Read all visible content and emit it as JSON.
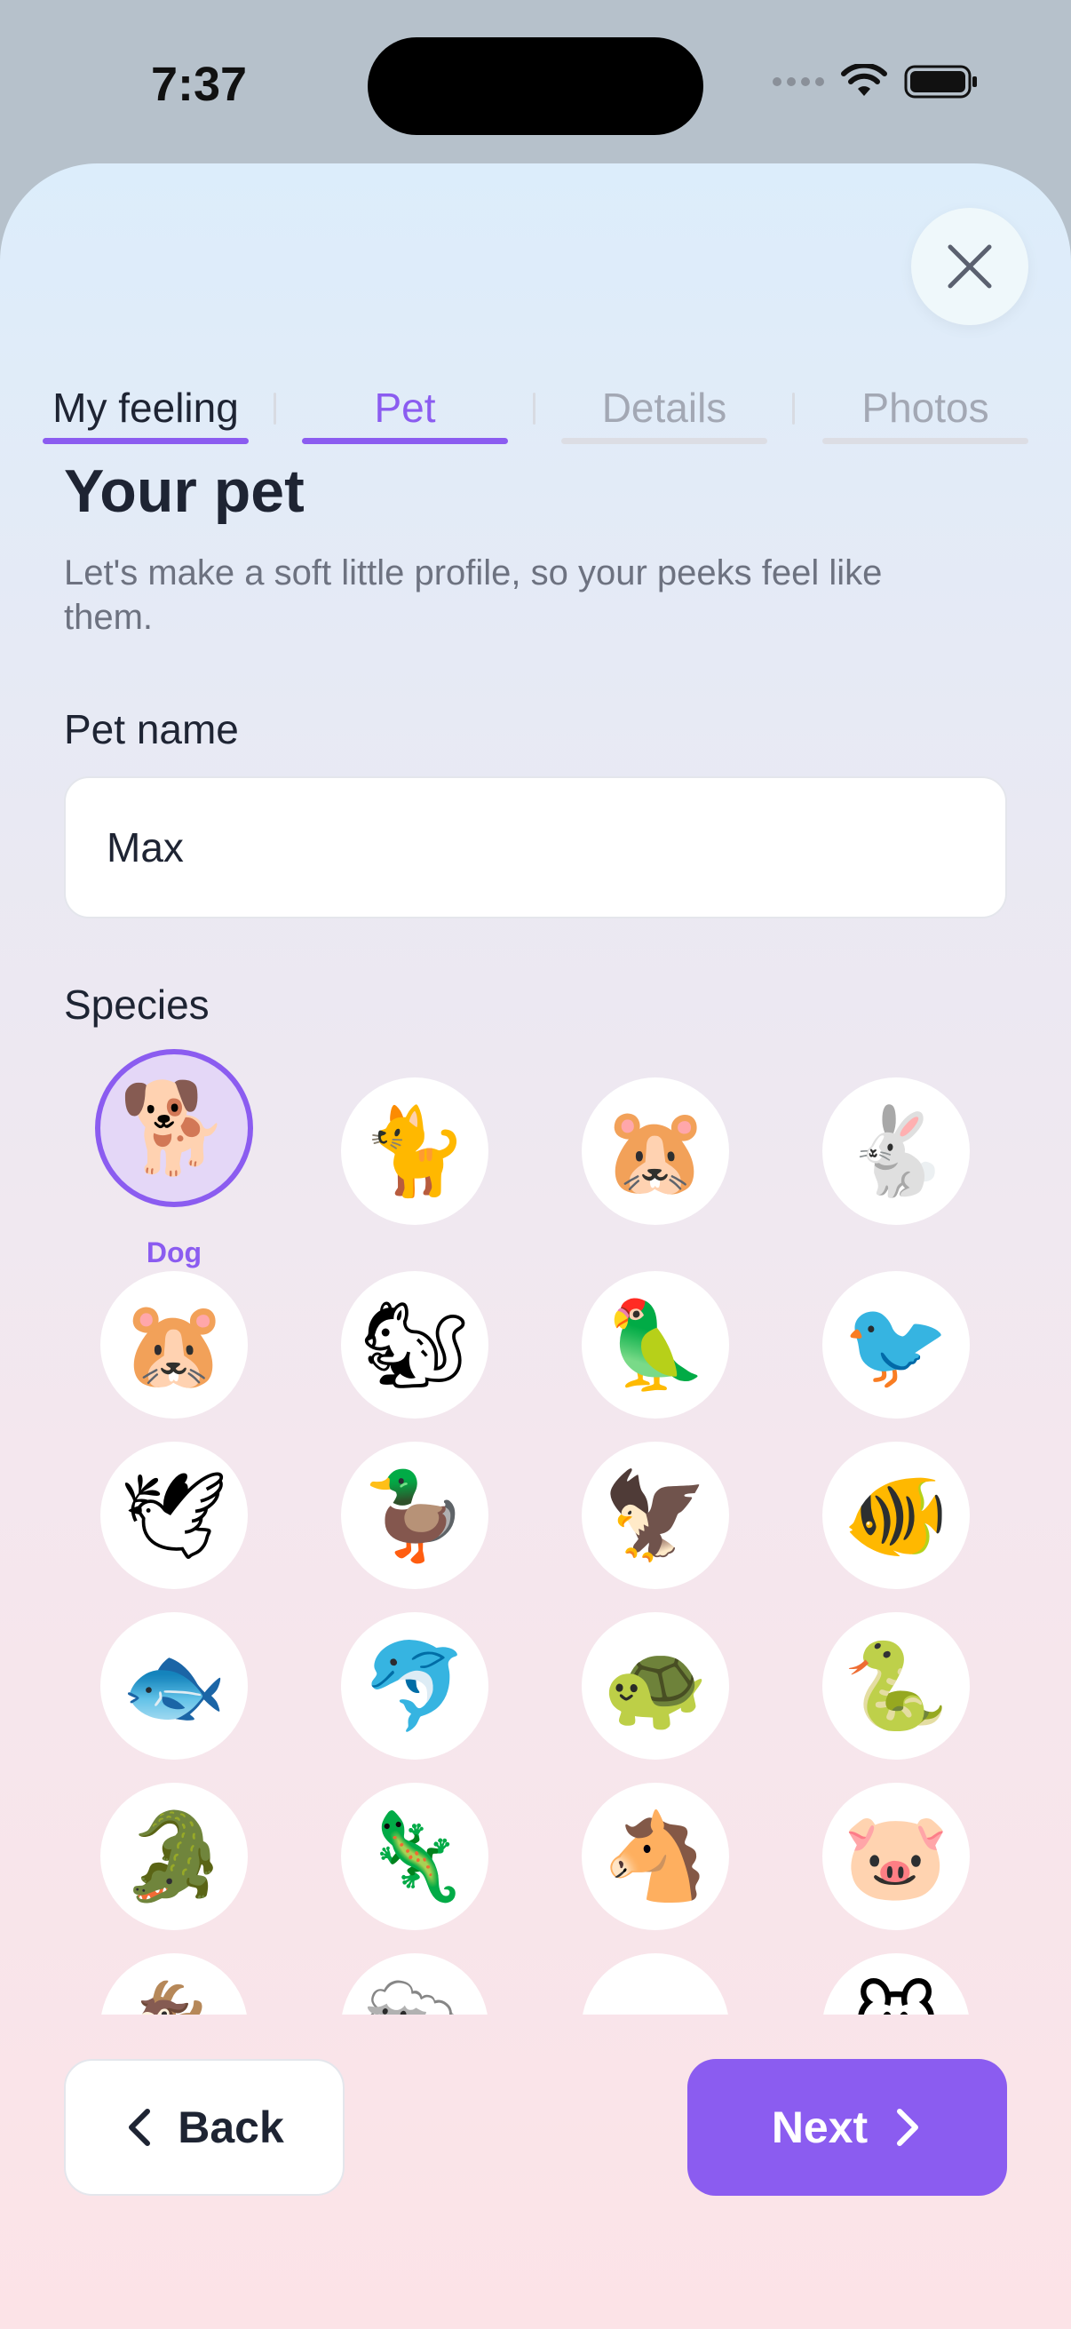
{
  "status": {
    "time": "7:37"
  },
  "tabs": [
    {
      "label": "My feeling",
      "state": "done"
    },
    {
      "label": "Pet",
      "state": "active"
    },
    {
      "label": "Details",
      "state": "todo"
    },
    {
      "label": "Photos",
      "state": "todo"
    }
  ],
  "header": {
    "title": "Your pet",
    "subtitle": "Let's make a soft little profile, so your peeks feel like them."
  },
  "pet_name": {
    "label": "Pet name",
    "value": "Max"
  },
  "species": {
    "label": "Species",
    "selected_label": "Dog",
    "items": [
      {
        "icon": "dog-icon",
        "glyph": "🐕",
        "selected": true
      },
      {
        "icon": "cat-icon",
        "glyph": "🐈"
      },
      {
        "icon": "hamster-icon",
        "glyph": "🐹"
      },
      {
        "icon": "rabbit-icon",
        "glyph": "🐇"
      },
      {
        "icon": "guinea-pig-icon",
        "glyph": "🐹"
      },
      {
        "icon": "squirrel-icon",
        "glyph": "🐿"
      },
      {
        "icon": "parrot-icon",
        "glyph": "🦜"
      },
      {
        "icon": "lovebird-icon",
        "glyph": "🐦"
      },
      {
        "icon": "pigeon-icon",
        "glyph": "🕊"
      },
      {
        "icon": "duck-icon",
        "glyph": "🦆"
      },
      {
        "icon": "eagle-icon",
        "glyph": "🦅"
      },
      {
        "icon": "goldfish-icon",
        "glyph": "🐠"
      },
      {
        "icon": "betta-fish-icon",
        "glyph": "🐟"
      },
      {
        "icon": "dolphin-icon",
        "glyph": "🐬"
      },
      {
        "icon": "turtle-icon",
        "glyph": "🐢"
      },
      {
        "icon": "snake-icon",
        "glyph": "🐍"
      },
      {
        "icon": "crocodile-icon",
        "glyph": "🐊"
      },
      {
        "icon": "lizard-icon",
        "glyph": "🦎"
      },
      {
        "icon": "horse-icon",
        "glyph": "🐴"
      },
      {
        "icon": "pig-icon",
        "glyph": "🐷"
      },
      {
        "icon": "goat-icon",
        "glyph": "🐐"
      },
      {
        "icon": "sheep-icon",
        "glyph": "🐑"
      },
      {
        "icon": "ferret-icon",
        "glyph": "🦡"
      },
      {
        "icon": "mouse-icon",
        "glyph": "🐭"
      }
    ]
  },
  "actions": {
    "back": "Back",
    "next": "Next"
  },
  "colors": {
    "accent": "#8b5cf0",
    "text": "#1e2433",
    "muted": "#6d7280",
    "inactive_tab": "#a3a8b4"
  }
}
